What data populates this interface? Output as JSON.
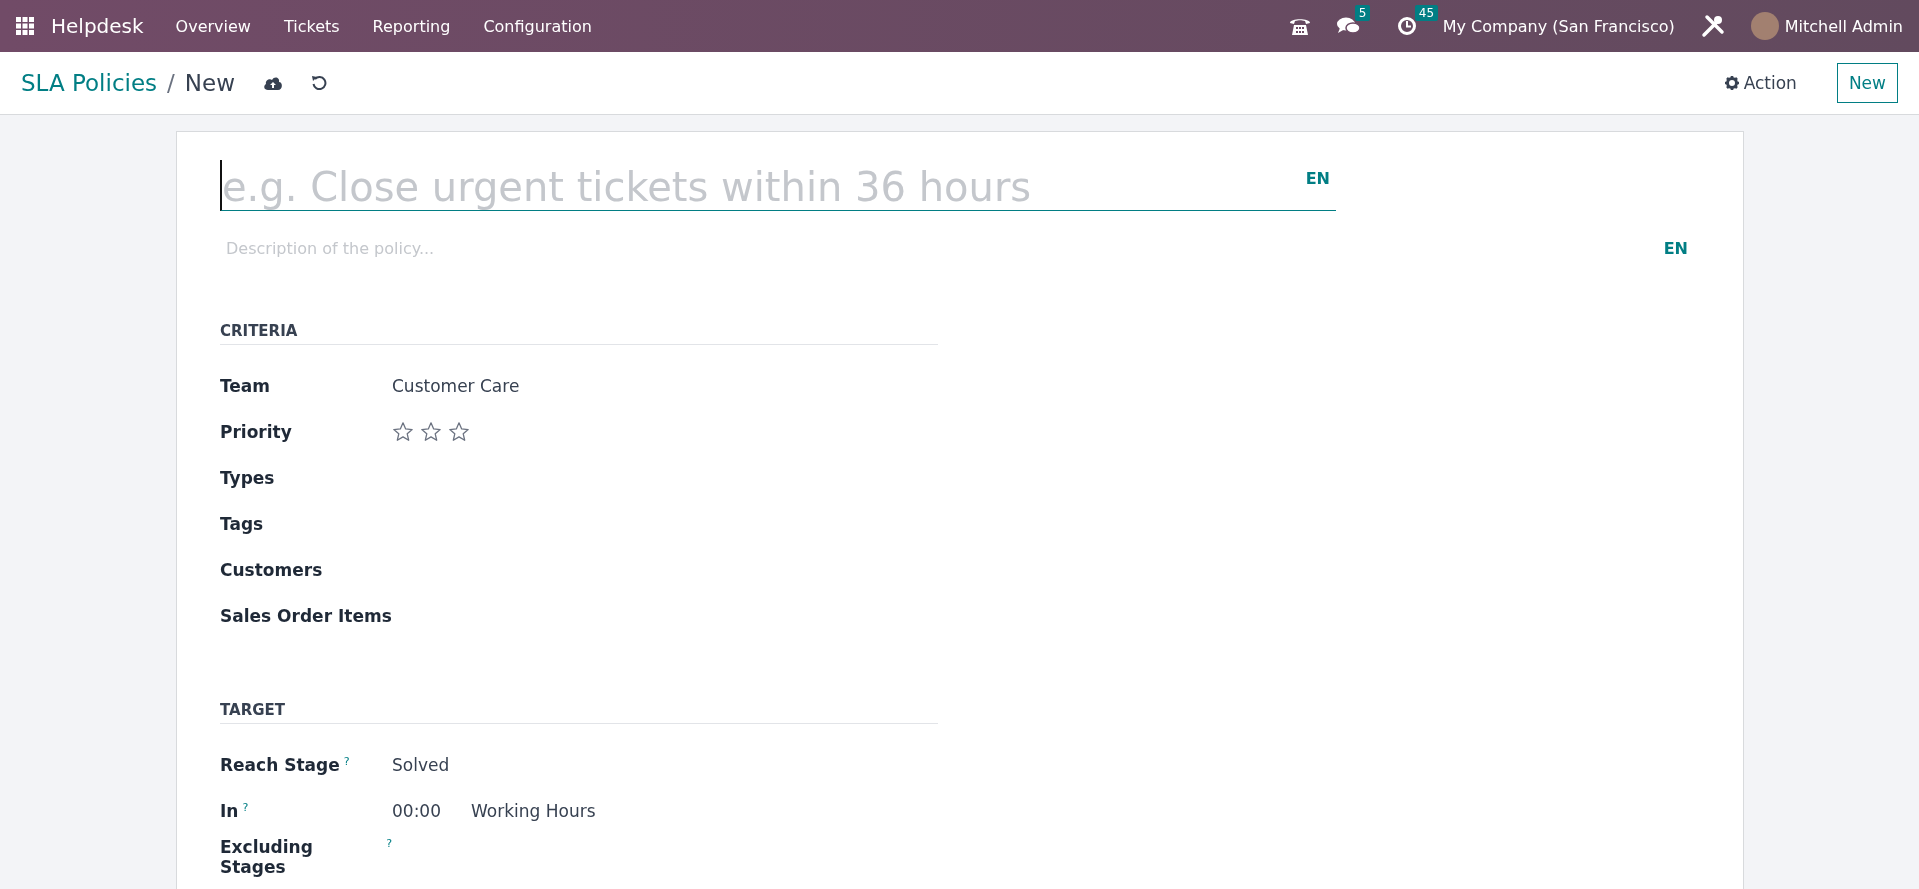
{
  "navbar": {
    "app_name": "Helpdesk",
    "menus": [
      "Overview",
      "Tickets",
      "Reporting",
      "Configuration"
    ],
    "messages_count": "5",
    "activities_count": "45",
    "company": "My Company (San Francisco)",
    "user": "Mitchell Admin"
  },
  "breadcrumb": {
    "parent": "SLA Policies",
    "separator": "/",
    "current": "New"
  },
  "actions": {
    "action_label": "Action",
    "new_label": "New"
  },
  "form": {
    "name_placeholder": "e.g. Close urgent tickets within 36 hours",
    "name_lang": "EN",
    "description_placeholder": "Description of the policy...",
    "description_lang": "EN",
    "sections": [
      {
        "title": "CRITERIA",
        "fields": [
          {
            "label": "Team",
            "kind": "text",
            "value": "Customer Care"
          },
          {
            "label": "Priority",
            "kind": "stars",
            "stars": 0
          },
          {
            "label": "Types",
            "kind": "empty"
          },
          {
            "label": "Tags",
            "kind": "empty"
          },
          {
            "label": "Customers",
            "kind": "empty"
          },
          {
            "label": "Sales Order Items",
            "kind": "empty"
          }
        ]
      },
      {
        "title": "TARGET",
        "fields": [
          {
            "label": "Reach Stage",
            "help": "?",
            "kind": "text",
            "value": "Solved"
          },
          {
            "label": "In",
            "help": "?",
            "kind": "duration",
            "value": "00:00",
            "unit": "Working Hours"
          },
          {
            "label": "Excluding Stages",
            "help": "?",
            "kind": "empty"
          }
        ]
      }
    ]
  }
}
